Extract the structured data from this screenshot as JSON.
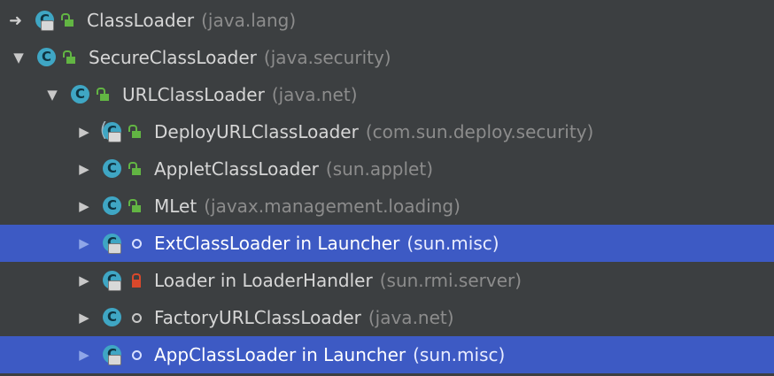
{
  "rows": [
    {
      "name": "ClassLoader",
      "pkg": "(java.lang)"
    },
    {
      "name": "SecureClassLoader",
      "pkg": "(java.security)"
    },
    {
      "name": "URLClassLoader",
      "pkg": "(java.net)"
    },
    {
      "name": "DeployURLClassLoader",
      "pkg": "(com.sun.deploy.security)"
    },
    {
      "name": "AppletClassLoader",
      "pkg": "(sun.applet)"
    },
    {
      "name": "MLet",
      "pkg": "(javax.management.loading)"
    },
    {
      "name": "ExtClassLoader in Launcher",
      "pkg": "(sun.misc)"
    },
    {
      "name": "Loader in LoaderHandler",
      "pkg": "(sun.rmi.server)"
    },
    {
      "name": "FactoryURLClassLoader",
      "pkg": "(java.net)"
    },
    {
      "name": "AppClassLoader in Launcher",
      "pkg": "(sun.misc)"
    }
  ],
  "icons": {
    "class_letter": "C",
    "expanded_arrow": "▼",
    "collapsed_arrow": "▶",
    "inherit_arrow": "➜"
  },
  "colors": {
    "background": "#3c3f41",
    "selection": "#3d5ac4",
    "class_icon": "#3fa6c4",
    "public_lock": "#62b543",
    "private_lock": "#d9482b"
  }
}
